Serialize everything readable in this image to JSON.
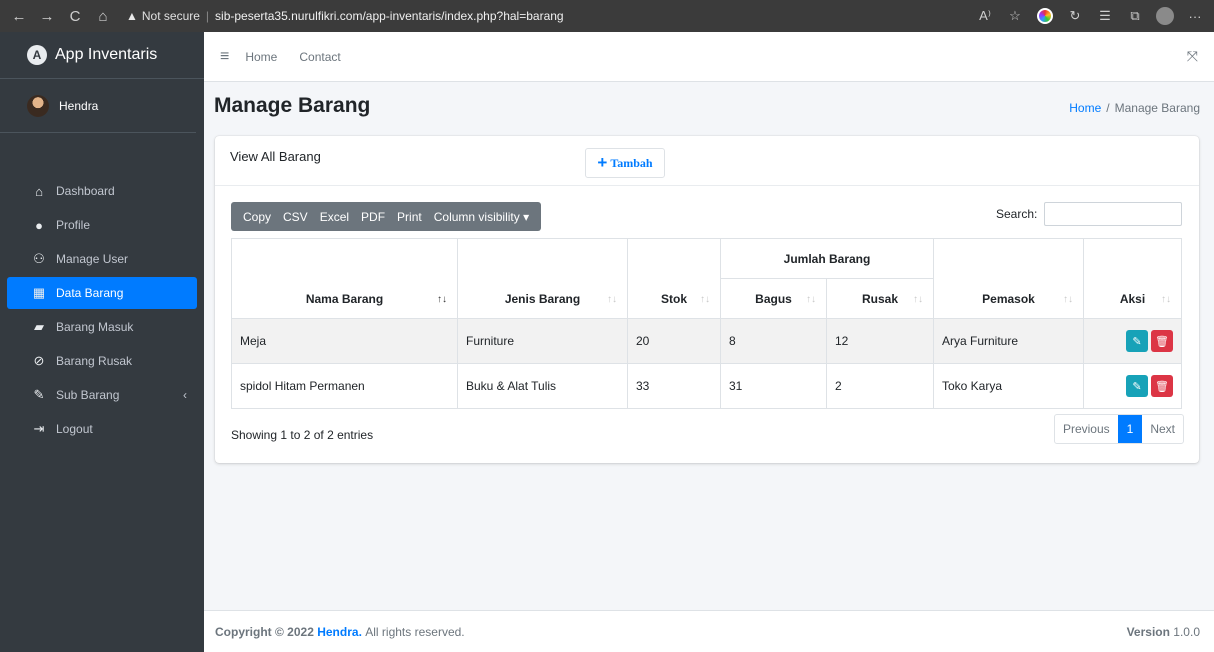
{
  "browser": {
    "back": "←",
    "forward": "→",
    "reload": "C",
    "home": "⌂",
    "security": "Not secure",
    "url": "sib-peserta35.nurulfikri.com/app-inventaris/index.php?hal=barang",
    "icons": [
      "read-aloud-icon",
      "favorite-icon",
      "color-extension-icon",
      "refresh-extension-icon",
      "favorites-icon",
      "collections-icon",
      "profile-icon",
      "more-icon"
    ]
  },
  "sidebar": {
    "brand": "App Inventaris",
    "brand_logo": "A",
    "user": "Hendra",
    "items": [
      {
        "label": "Dashboard",
        "icon": "⌂"
      },
      {
        "label": "Profile",
        "icon": "●"
      },
      {
        "label": "Manage User",
        "icon": "⚇"
      },
      {
        "label": "Data Barang",
        "icon": "▦"
      },
      {
        "label": "Barang Masuk",
        "icon": "▰"
      },
      {
        "label": "Barang Rusak",
        "icon": "⊘"
      },
      {
        "label": "Sub Barang",
        "icon": "✎",
        "chevron": "‹"
      },
      {
        "label": "Logout",
        "icon": "⇥"
      }
    ]
  },
  "topnav": {
    "menu_icon": "≡",
    "home": "Home",
    "contact": "Contact",
    "expand_icon": "⤧"
  },
  "page": {
    "title": "Manage Barang",
    "breadcrumb_home": "Home",
    "breadcrumb_sep": "/",
    "breadcrumb_current": "Manage Barang"
  },
  "card": {
    "title": "View All Barang",
    "add_label": "Tambah",
    "add_icon": "+",
    "buttons": [
      "Copy",
      "CSV",
      "Excel",
      "PDF",
      "Print",
      "Column visibility ▾"
    ],
    "search_label": "Search:",
    "search_value": ""
  },
  "table": {
    "group_header": "Jumlah Barang",
    "columns": [
      "Nama Barang",
      "Jenis Barang",
      "Stok",
      "Bagus",
      "Rusak",
      "Pemasok",
      "Aksi"
    ],
    "rows": [
      {
        "nama": "Meja",
        "jenis": "Furniture",
        "stok": "20",
        "bagus": "8",
        "rusak": "12",
        "pemasok": "Arya Furniture"
      },
      {
        "nama": "spidol Hitam Permanen",
        "jenis": "Buku & Alat Tulis",
        "stok": "33",
        "bagus": "31",
        "rusak": "2",
        "pemasok": "Toko Karya"
      }
    ],
    "info": "Showing 1 to 2 of 2 entries",
    "pager": {
      "prev": "Previous",
      "current": "1",
      "next": "Next"
    }
  },
  "footer": {
    "prefix": "Copyright © 2022",
    "brand": "Hendra.",
    "suffix": "All rights reserved.",
    "version_label": "Version",
    "version": "1.0.0"
  }
}
